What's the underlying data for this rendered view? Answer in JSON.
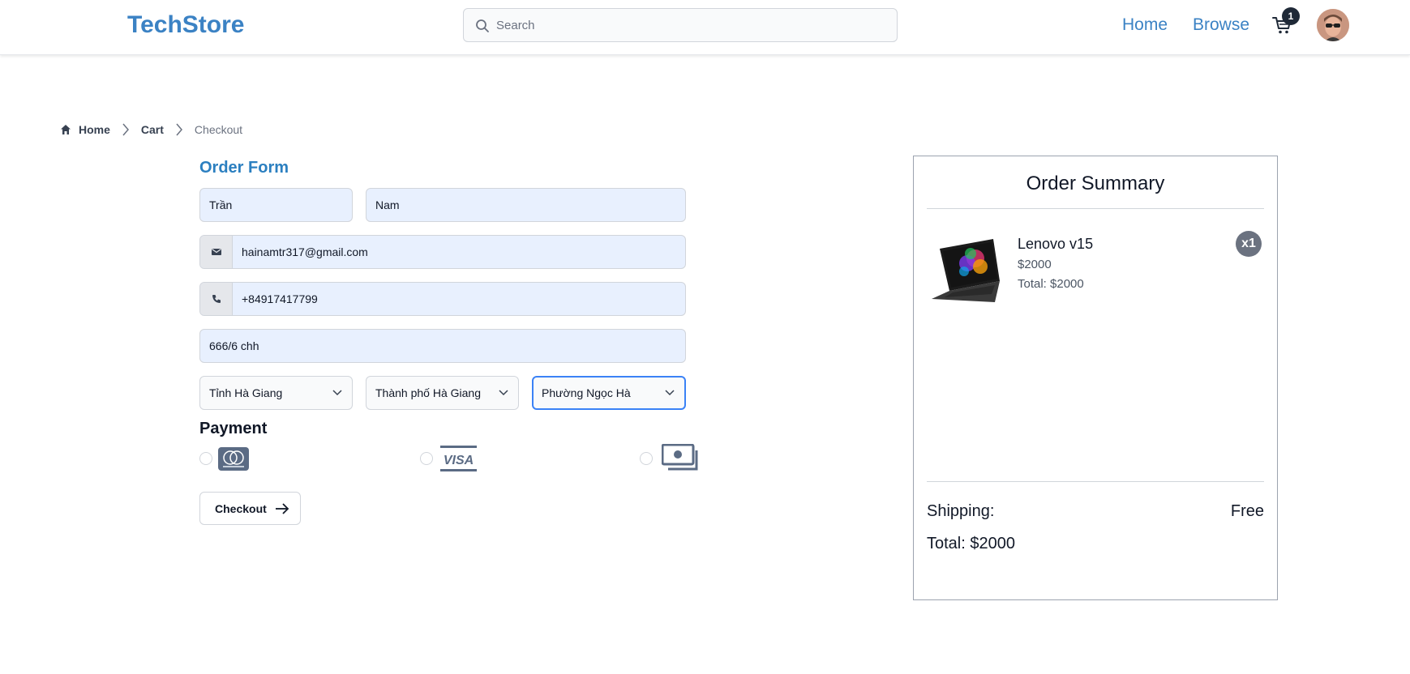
{
  "header": {
    "brand": "TechStore",
    "search_placeholder": "Search",
    "nav": [
      "Home",
      "Browse"
    ],
    "cart_count": "1"
  },
  "breadcrumb": {
    "home": "Home",
    "cart": "Cart",
    "current": "Checkout"
  },
  "order_form": {
    "title": "Order Form",
    "first_name": "Trần",
    "last_name": "Nam",
    "email": "hainamtr317@gmail.com",
    "phone": "+84917417799",
    "address": "666/6 chh",
    "province": "Tỉnh Hà Giang",
    "city": "Thành phố Hà Giang",
    "ward": "Phường Ngọc Hà",
    "payment_title": "Payment",
    "payment_methods": [
      "mastercard-icon",
      "visa-icon",
      "cash-icon"
    ],
    "checkout_label": "Checkout"
  },
  "summary": {
    "title": "Order Summary",
    "item": {
      "name": "Lenovo v15",
      "price": "$2000",
      "total": "Total: $2000",
      "qty": "x1"
    },
    "shipping_label": "Shipping:",
    "shipping_value": "Free",
    "total": "Total: $2000"
  },
  "colors": {
    "brand": "#3b82c4",
    "field_bg": "#e8f0fe",
    "focus": "#3b82f6",
    "badge": "#6b7280"
  }
}
